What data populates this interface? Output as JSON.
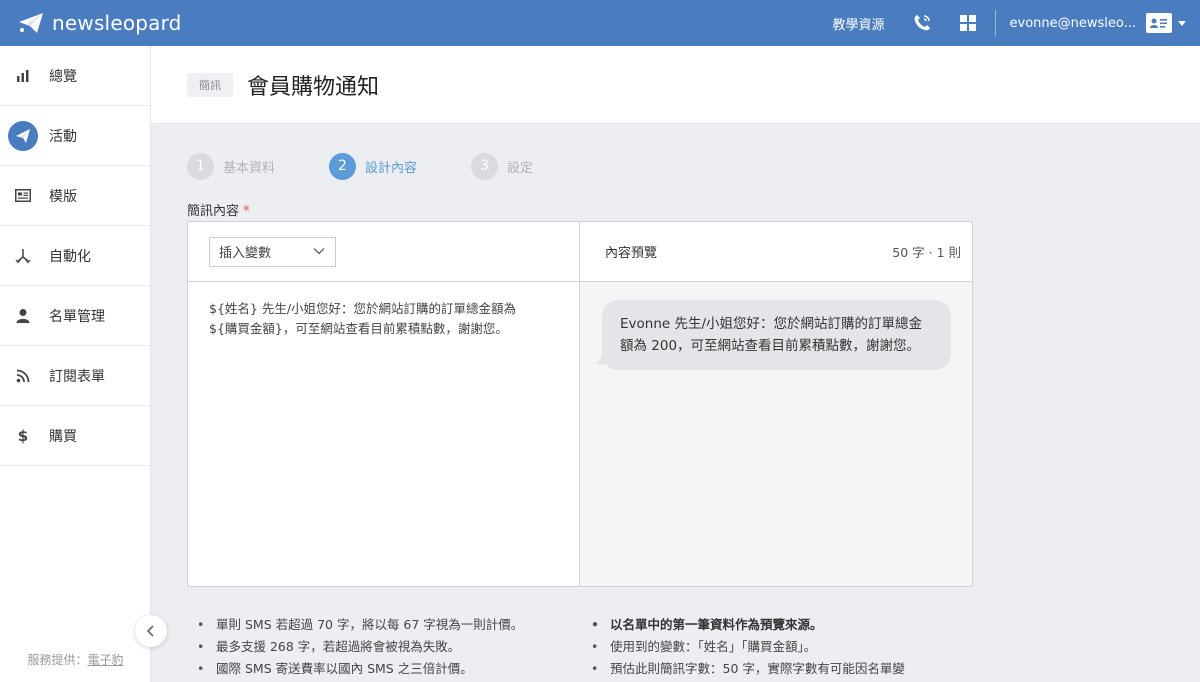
{
  "brand": {
    "name": "newsleopard"
  },
  "topbar": {
    "resources_label": "教學資源",
    "user_email": "evonne@newsleo...",
    "icons": [
      "phone-icon",
      "grid-icon",
      "contact-card-icon"
    ]
  },
  "sidebar": {
    "items": [
      {
        "label": "總覽",
        "icon": "bar-chart-icon",
        "active": false
      },
      {
        "label": "活動",
        "icon": "paper-plane-icon",
        "active": true
      },
      {
        "label": "模版",
        "icon": "template-icon",
        "active": false
      },
      {
        "label": "自動化",
        "icon": "branch-icon",
        "active": false
      },
      {
        "label": "名單管理",
        "icon": "user-icon",
        "active": false
      },
      {
        "label": "訂閱表單",
        "icon": "rss-icon",
        "active": false
      },
      {
        "label": "購買",
        "icon": "dollar-icon",
        "active": false
      }
    ],
    "footer_prefix": "服務提供：",
    "footer_link": "電子豹"
  },
  "header": {
    "badge": "簡訊",
    "title": "會員購物通知"
  },
  "steps": [
    {
      "num": "1",
      "label": "基本資料",
      "active": false
    },
    {
      "num": "2",
      "label": "設計內容",
      "active": true
    },
    {
      "num": "3",
      "label": "設定",
      "active": false
    }
  ],
  "editor": {
    "field_label": "簡訊內容",
    "required_mark": "*",
    "insert_variable_label": "插入變數",
    "content_line1": "${姓名} 先生/小姐您好：您於網站訂購的訂單總金額為",
    "content_line2": "${購買金額}，可至網站查看目前累積點數，謝謝您。"
  },
  "preview": {
    "title": "內容預覽",
    "count": "50 字 · 1 則",
    "line1": "Evonne 先生/小姐您好：您於網站訂購的訂單總金",
    "line2": "額為 200，可至網站查看目前累積點數，謝謝您。"
  },
  "notes_left": [
    "單則 SMS 若超過 70 字，將以每 67 字視為一則計價。",
    "最多支援 268 字，若超過將會被視為失敗。",
    "國際 SMS 寄送費率以國內 SMS 之三倍計價。"
  ],
  "notes_right": [
    "以名單中的第一筆資料作為預覽來源。",
    "使用到的變數：「姓名」「購買金額」。",
    "預估此則簡訊字數：50 字，實際字數有可能因名單變"
  ],
  "colors": {
    "topbar": "#4a7cc0",
    "active_step": "#5a9bd8",
    "page_bg": "#eceef2"
  }
}
